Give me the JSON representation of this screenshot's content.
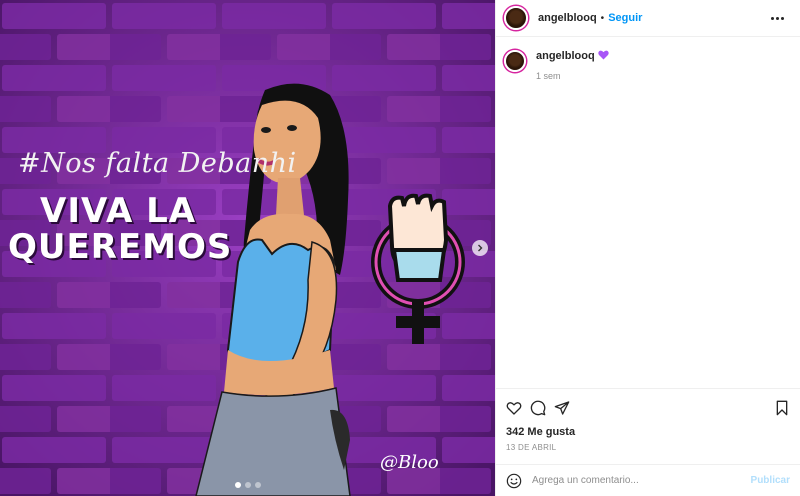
{
  "image": {
    "hashtag": "#Nos falta Debanhi",
    "headline_line1": "VIVA LA",
    "headline_line2": "QUEREMOS",
    "signature": "@Bloo"
  },
  "header": {
    "username": "angelblooq",
    "separator": "•",
    "follow_label": "Seguir",
    "more_icon": "more-horizontal-icon"
  },
  "caption": {
    "username": "angelblooq",
    "emoji": "purple-heart-icon",
    "time": "1 sem"
  },
  "actions": {
    "icons": [
      "heart-icon",
      "comment-icon",
      "share-icon",
      "bookmark-icon"
    ],
    "likes": "342 Me gusta",
    "date": "13 DE ABRIL"
  },
  "comment_box": {
    "placeholder": "Agrega un comentario...",
    "publish_label": "Publicar"
  },
  "colors": {
    "link": "#0095f6",
    "publish_disabled": "#b2dffc",
    "purple_heart": "#a855f7"
  }
}
